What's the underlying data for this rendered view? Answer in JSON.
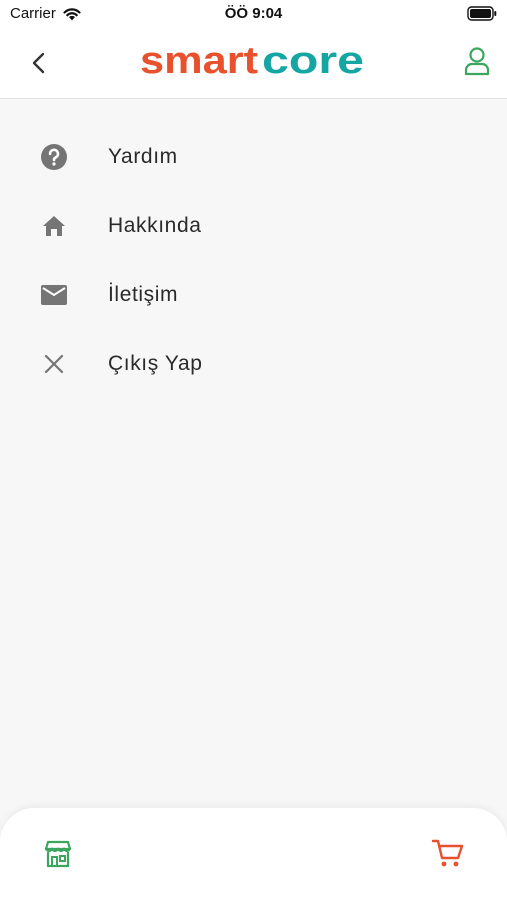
{
  "status_bar": {
    "carrier": "Carrier",
    "time": "ÖÖ 9:04"
  },
  "header": {
    "logo_part1": "smart",
    "logo_part2": "core"
  },
  "menu": {
    "items": [
      {
        "label": "Yardım",
        "icon": "help-icon"
      },
      {
        "label": "Hakkında",
        "icon": "home-icon"
      },
      {
        "label": "İletişim",
        "icon": "mail-icon"
      },
      {
        "label": "Çıkış Yap",
        "icon": "close-icon"
      }
    ]
  },
  "colors": {
    "accent_green": "#3aa65e",
    "logo_red": "#e8512d",
    "logo_teal": "#15a6a3",
    "cart_orange": "#e8512d",
    "icon_gray": "#757575"
  }
}
